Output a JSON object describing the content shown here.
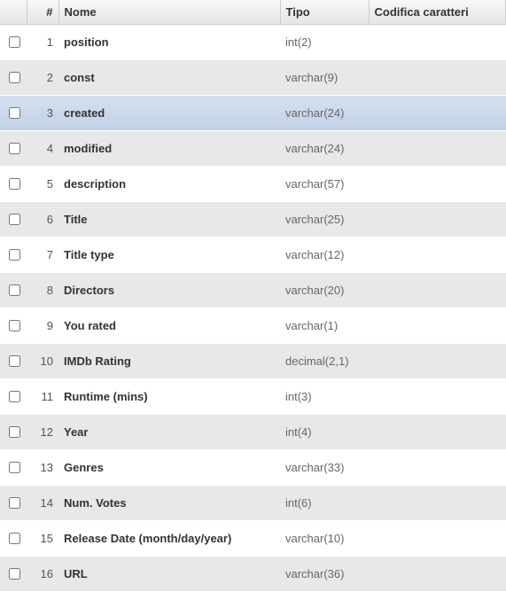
{
  "columns": {
    "checkbox_header": "",
    "num_header": "#",
    "name_header": "Nome",
    "type_header": "Tipo",
    "encoding_header": "Codifica caratteri"
  },
  "rows": [
    {
      "num": "1",
      "name": "position",
      "type": "int(2)",
      "highlight": false
    },
    {
      "num": "2",
      "name": "const",
      "type": "varchar(9)",
      "highlight": false
    },
    {
      "num": "3",
      "name": "created",
      "type": "varchar(24)",
      "highlight": true
    },
    {
      "num": "4",
      "name": "modified",
      "type": "varchar(24)",
      "highlight": false
    },
    {
      "num": "5",
      "name": "description",
      "type": "varchar(57)",
      "highlight": false
    },
    {
      "num": "6",
      "name": "Title",
      "type": "varchar(25)",
      "highlight": false
    },
    {
      "num": "7",
      "name": "Title type",
      "type": "varchar(12)",
      "highlight": false
    },
    {
      "num": "8",
      "name": "Directors",
      "type": "varchar(20)",
      "highlight": false
    },
    {
      "num": "9",
      "name": "You rated",
      "type": "varchar(1)",
      "highlight": false
    },
    {
      "num": "10",
      "name": "IMDb Rating",
      "type": "decimal(2,1)",
      "highlight": false
    },
    {
      "num": "11",
      "name": "Runtime (mins)",
      "type": "int(3)",
      "highlight": false
    },
    {
      "num": "12",
      "name": "Year",
      "type": "int(4)",
      "highlight": false
    },
    {
      "num": "13",
      "name": "Genres",
      "type": "varchar(33)",
      "highlight": false
    },
    {
      "num": "14",
      "name": "Num. Votes",
      "type": "int(6)",
      "highlight": false
    },
    {
      "num": "15",
      "name": "Release Date (month/day/year)",
      "type": "varchar(10)",
      "highlight": false
    },
    {
      "num": "16",
      "name": "URL",
      "type": "varchar(36)",
      "highlight": false
    }
  ]
}
